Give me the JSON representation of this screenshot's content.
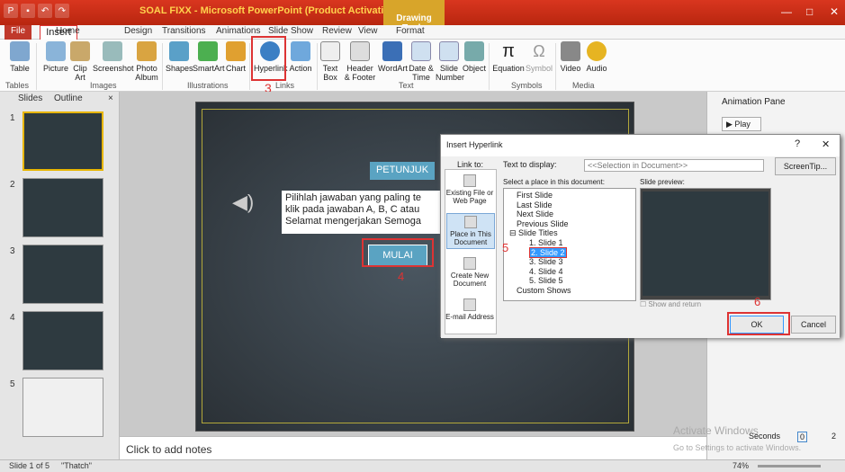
{
  "title_bar": {
    "app_title": "SOAL FIXX - Microsoft PowerPoint (Product Activation Failed)",
    "context_tab": "Drawing Tools",
    "window_controls": [
      "—",
      "□",
      "✕"
    ]
  },
  "ribbon_tabs": [
    "File",
    "Home",
    "Insert",
    "Design",
    "Transitions",
    "Animations",
    "Slide Show",
    "Review",
    "View",
    "Format"
  ],
  "ribbon": {
    "buttons": [
      {
        "label": "Table",
        "icon": "table-icon"
      },
      {
        "label": "Picture",
        "icon": "picture-icon"
      },
      {
        "label": "Clip Art",
        "icon": "clipart-icon"
      },
      {
        "label": "Screenshot",
        "icon": "screenshot-icon"
      },
      {
        "label": "Photo Album",
        "icon": "photo-album-icon"
      },
      {
        "label": "Shapes",
        "icon": "shapes-icon"
      },
      {
        "label": "SmartArt",
        "icon": "smartart-icon"
      },
      {
        "label": "Chart",
        "icon": "chart-icon"
      },
      {
        "label": "Hyperlink",
        "icon": "hyperlink-icon"
      },
      {
        "label": "Action",
        "icon": "action-icon"
      },
      {
        "label": "Text Box",
        "icon": "textbox-icon"
      },
      {
        "label": "Header & Footer",
        "icon": "header-footer-icon"
      },
      {
        "label": "WordArt",
        "icon": "wordart-icon"
      },
      {
        "label": "Date & Time",
        "icon": "date-time-icon"
      },
      {
        "label": "Slide Number",
        "icon": "slide-number-icon"
      },
      {
        "label": "Object",
        "icon": "object-icon"
      },
      {
        "label": "Equation",
        "icon": "equation-icon"
      },
      {
        "label": "Symbol",
        "icon": "symbol-icon"
      },
      {
        "label": "Video",
        "icon": "video-icon"
      },
      {
        "label": "Audio",
        "icon": "audio-icon"
      }
    ],
    "groups": [
      "Tables",
      "Images",
      "Illustrations",
      "Links",
      "Text",
      "Symbols",
      "Media"
    ],
    "step3": "3"
  },
  "left_pane": {
    "tabs": [
      "Slides",
      "Outline"
    ],
    "slide_numbers": [
      "1",
      "2",
      "3",
      "4",
      "5"
    ]
  },
  "slide": {
    "heading": "PETUNJUK",
    "bullet1": "Pilihlah jawaban yang paling te",
    "bullet1b": "klik pada jawaban A, B, C atau",
    "bullet2": "Selamat mengerjakan Semoga",
    "button": "MULAI",
    "step4": "4"
  },
  "notes_placeholder": "Click to add notes",
  "animation_pane": {
    "title": "Animation Pane",
    "play": "Play",
    "seconds": "Seconds",
    "zero": "0",
    "page": "2"
  },
  "dialog": {
    "title": "Insert Hyperlink",
    "help": "?",
    "close": "✕",
    "link_to": "Link to:",
    "text_to_display_label": "Text to display:",
    "text_to_display_value": "<<Selection in Document>>",
    "screentip": "ScreenTip...",
    "place_label": "Select a place in this document:",
    "preview_label": "Slide preview:",
    "link_options": [
      "Existing File or Web Page",
      "Place in This Document",
      "Create New Document",
      "E-mail Address"
    ],
    "tree": [
      "First Slide",
      "Last Slide",
      "Next Slide",
      "Previous Slide",
      "Slide Titles",
      "1. Slide 1",
      "2. Slide 2",
      "3. Slide 3",
      "4. Slide 4",
      "5. Slide 5",
      "Custom Shows"
    ],
    "show_return": "Show and return",
    "ok": "OK",
    "cancel": "Cancel",
    "step5": "5",
    "step6": "6"
  },
  "status_bar": {
    "slide_info": "Slide 1 of 5",
    "theme": "\"Thatch\"",
    "zoom": "74%"
  },
  "watermark": {
    "line1": "Activate Windows",
    "line2": "Go to Settings to activate Windows."
  },
  "colors": {
    "accent_red": "#d33333",
    "slide_button": "#5aa3c2"
  }
}
